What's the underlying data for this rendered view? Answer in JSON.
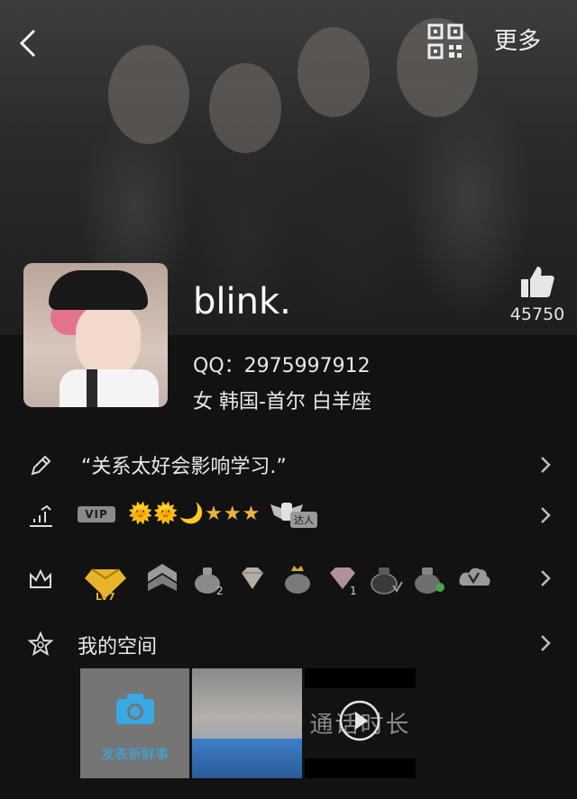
{
  "header": {
    "back_icon": "back-chevron-icon",
    "qr_icon": "qr-code-icon",
    "more_label": "更多"
  },
  "profile": {
    "username": "blink.",
    "like_count": "45750",
    "qq_line": "QQ：2975997912",
    "info_line": "女 韩国-首尔 白羊座"
  },
  "rows": {
    "signature": "“关系太好会影响学习.”",
    "vip_badge": "VIP",
    "level_icons": "🌞🌞🌙★★★",
    "daren_tag": "达人",
    "space_label": "我的空间"
  },
  "badges": [
    "LV7"
  ],
  "space": {
    "post_label": "发表新鲜事",
    "video_overlay_text": "通话时长"
  },
  "colors": {
    "background": "#121212",
    "accent_blue": "#38a9e3",
    "gold": "#e9b43b"
  }
}
